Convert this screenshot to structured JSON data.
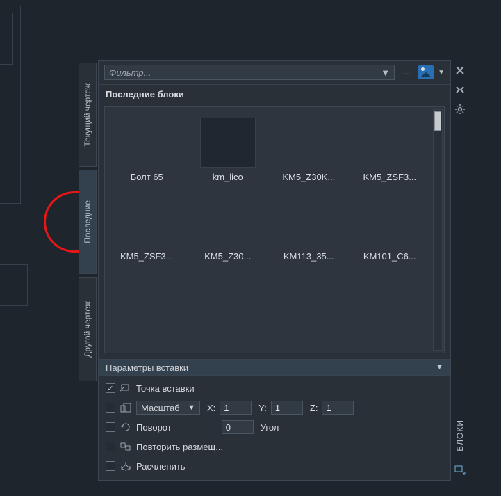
{
  "palette_title": "БЛОКИ",
  "tabs": [
    {
      "label": "Текущий чертеж",
      "active": false
    },
    {
      "label": "Последние",
      "active": true
    },
    {
      "label": "Другой чертеж",
      "active": false
    }
  ],
  "filter": {
    "placeholder": "Фильтр..."
  },
  "section_title": "Последние блоки",
  "blocks": [
    {
      "label": "Болт 65",
      "selected": false
    },
    {
      "label": "km_lico",
      "selected": true
    },
    {
      "label": "KM5_Z30K...",
      "selected": false
    },
    {
      "label": "KM5_ZSF3...",
      "selected": false
    },
    {
      "label": "KM5_ZSF3...",
      "selected": false
    },
    {
      "label": "KM5_Z30...",
      "selected": false
    },
    {
      "label": "KM113_35...",
      "selected": false
    },
    {
      "label": "KM101_C6...",
      "selected": false
    }
  ],
  "params": {
    "header": "Параметры вставки",
    "insertion_point": {
      "checked": true,
      "label": "Точка вставки"
    },
    "scale": {
      "checked": false,
      "label": "Масштаб",
      "x_label": "X:",
      "x": "1",
      "y_label": "Y:",
      "y": "1",
      "z_label": "Z:",
      "z": "1"
    },
    "rotation": {
      "checked": false,
      "label": "Поворот",
      "value": "0",
      "unit_label": "Угол"
    },
    "repeat": {
      "checked": false,
      "label": "Повторить размещ..."
    },
    "explode": {
      "checked": false,
      "label": "Расчленить"
    }
  },
  "toolbar": {
    "ellipsis": "...",
    "dropdown_glyph": "▼"
  }
}
